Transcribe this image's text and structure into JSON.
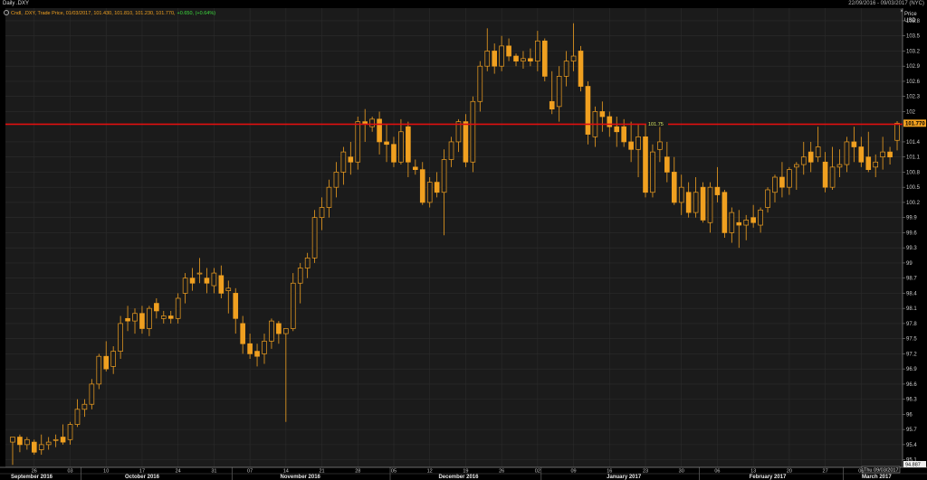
{
  "window": {
    "title": "Daily .DXY",
    "date_range": "22/09/2016 - 09/03/2017 (NYC)"
  },
  "legend": {
    "description": "Cndl, .DXY, Trade Price, 01/03/2017, 101.430, 101.810, 101.230, 101.770,",
    "change": "+0.650, (+0.64%)"
  },
  "colors": {
    "background": "#000000",
    "plot_background": "#1b1b1b",
    "candle": "#f0a020",
    "level_line": "#e01010",
    "last_price_tag": "#f0a020",
    "change_positive": "#3ddc3d"
  },
  "icons": [
    "gear-icon",
    "close-icon"
  ],
  "chart_data": {
    "type": "candlestick",
    "title": "Daily .DXY",
    "ylabel_top": "Price",
    "ylabel_unit": "USD",
    "ylim": [
      94.95,
      104.05
    ],
    "y_ticks": [
      "103.8",
      "103.5",
      "103.2",
      "102.9",
      "102.6",
      "102.3",
      "102",
      "101.4",
      "101.1",
      "100.8",
      "100.5",
      "100.2",
      "99.9",
      "99.6",
      "99.3",
      "99",
      "98.7",
      "98.4",
      "98.1",
      "97.8",
      "97.5",
      "97.2",
      "96.9",
      "96.6",
      "96.3",
      "96",
      "95.7",
      "95.4",
      "95.1"
    ],
    "x_ticks": [
      {
        "label": "26",
        "i": 3
      },
      {
        "label": "03",
        "i": 8
      },
      {
        "label": "10",
        "i": 13
      },
      {
        "label": "17",
        "i": 18
      },
      {
        "label": "24",
        "i": 23
      },
      {
        "label": "31",
        "i": 28
      },
      {
        "label": "07",
        "i": 33
      },
      {
        "label": "14",
        "i": 38
      },
      {
        "label": "21",
        "i": 43
      },
      {
        "label": "28",
        "i": 48
      },
      {
        "label": "05",
        "i": 53
      },
      {
        "label": "12",
        "i": 58
      },
      {
        "label": "19",
        "i": 63
      },
      {
        "label": "26",
        "i": 68
      },
      {
        "label": "02",
        "i": 73
      },
      {
        "label": "09",
        "i": 78
      },
      {
        "label": "16",
        "i": 83
      },
      {
        "label": "23",
        "i": 88
      },
      {
        "label": "30",
        "i": 93
      },
      {
        "label": "06",
        "i": 98
      },
      {
        "label": "13",
        "i": 103
      },
      {
        "label": "20",
        "i": 108
      },
      {
        "label": "27",
        "i": 113
      },
      {
        "label": "06",
        "i": 118
      }
    ],
    "months": [
      {
        "label": "September 2016",
        "i": 3
      },
      {
        "label": "October 2016",
        "i": 18
      },
      {
        "label": "November 2016",
        "i": 40
      },
      {
        "label": "December 2016",
        "i": 62
      },
      {
        "label": "January 2017",
        "i": 85
      },
      {
        "label": "February 2017",
        "i": 105
      },
      {
        "label": "March 2017",
        "i": 118
      }
    ],
    "month_separators": [
      9.5,
      30.5,
      52.5,
      73.5,
      95.5,
      115.5
    ],
    "level_line": {
      "value": 101.75,
      "label": "101.75"
    },
    "last_price": {
      "value": "101.770"
    },
    "bottom_price": {
      "value": "94.887"
    },
    "cursor_date": "Thu 09/03/2017",
    "candles": [
      [
        95.45,
        95.55,
        95.0,
        95.55
      ],
      [
        95.55,
        95.6,
        95.25,
        95.4
      ],
      [
        95.4,
        95.55,
        95.3,
        95.5
      ],
      [
        95.45,
        95.5,
        95.2,
        95.25
      ],
      [
        95.3,
        95.6,
        95.2,
        95.4
      ],
      [
        95.4,
        95.55,
        95.3,
        95.45
      ],
      [
        95.5,
        95.6,
        95.35,
        95.5
      ],
      [
        95.55,
        95.8,
        95.4,
        95.45
      ],
      [
        95.5,
        95.85,
        95.4,
        95.8
      ],
      [
        95.8,
        96.3,
        95.75,
        96.1
      ],
      [
        96.1,
        96.3,
        95.95,
        96.2
      ],
      [
        96.2,
        96.7,
        96.1,
        96.6
      ],
      [
        96.6,
        97.2,
        96.5,
        97.15
      ],
      [
        97.15,
        97.45,
        96.85,
        96.9
      ],
      [
        96.95,
        97.35,
        96.8,
        97.25
      ],
      [
        97.25,
        97.95,
        97.1,
        97.8
      ],
      [
        97.9,
        98.15,
        97.65,
        97.85
      ],
      [
        97.85,
        98.1,
        97.6,
        98.0
      ],
      [
        98.0,
        98.15,
        97.6,
        97.7
      ],
      [
        97.7,
        98.15,
        97.55,
        98.1
      ],
      [
        98.2,
        98.3,
        97.9,
        98.05
      ],
      [
        97.9,
        98.05,
        97.8,
        97.95
      ],
      [
        97.95,
        98.05,
        97.8,
        97.9
      ],
      [
        97.9,
        98.4,
        97.8,
        98.3
      ],
      [
        98.4,
        98.8,
        98.2,
        98.7
      ],
      [
        98.7,
        98.9,
        98.45,
        98.6
      ],
      [
        98.8,
        99.1,
        98.6,
        98.8
      ],
      [
        98.7,
        98.9,
        98.4,
        98.6
      ],
      [
        98.55,
        98.9,
        98.4,
        98.8
      ],
      [
        98.75,
        98.95,
        98.3,
        98.4
      ],
      [
        98.45,
        98.65,
        98.0,
        98.5
      ],
      [
        98.4,
        98.5,
        97.6,
        97.9
      ],
      [
        97.8,
        97.95,
        97.2,
        97.4
      ],
      [
        97.4,
        97.6,
        97.1,
        97.2
      ],
      [
        97.25,
        97.4,
        96.95,
        97.15
      ],
      [
        97.2,
        97.6,
        97.0,
        97.45
      ],
      [
        97.45,
        97.9,
        97.3,
        97.85
      ],
      [
        97.8,
        97.85,
        97.4,
        97.6
      ],
      [
        97.6,
        97.7,
        95.85,
        97.7
      ],
      [
        97.7,
        98.8,
        97.65,
        98.6
      ],
      [
        98.6,
        99.0,
        98.2,
        98.9
      ],
      [
        98.9,
        99.2,
        98.7,
        99.1
      ],
      [
        99.1,
        100.05,
        99.0,
        99.9
      ],
      [
        99.9,
        100.3,
        99.65,
        100.1
      ],
      [
        100.1,
        100.65,
        99.9,
        100.5
      ],
      [
        100.5,
        101.0,
        100.3,
        100.8
      ],
      [
        100.8,
        101.3,
        100.55,
        101.2
      ],
      [
        101.1,
        101.4,
        100.75,
        101.0
      ],
      [
        101.0,
        101.9,
        100.85,
        101.8
      ],
      [
        101.8,
        102.05,
        101.4,
        101.75
      ],
      [
        101.7,
        101.9,
        101.6,
        101.85
      ],
      [
        101.85,
        102.0,
        101.15,
        101.4
      ],
      [
        101.4,
        101.75,
        101.0,
        101.35
      ],
      [
        101.35,
        101.5,
        100.9,
        101.0
      ],
      [
        101.0,
        101.85,
        100.95,
        101.6
      ],
      [
        101.7,
        101.8,
        100.7,
        101.0
      ],
      [
        100.9,
        101.05,
        100.75,
        100.85
      ],
      [
        100.85,
        101.0,
        100.15,
        100.2
      ],
      [
        100.2,
        100.7,
        100.1,
        100.6
      ],
      [
        100.6,
        100.8,
        100.3,
        100.4
      ],
      [
        100.4,
        101.25,
        99.55,
        101.05
      ],
      [
        101.05,
        101.5,
        100.9,
        101.4
      ],
      [
        101.4,
        101.85,
        101.2,
        101.8
      ],
      [
        101.8,
        101.95,
        100.9,
        101.0
      ],
      [
        101.0,
        102.3,
        100.8,
        102.2
      ],
      [
        102.2,
        103.0,
        102.0,
        102.9
      ],
      [
        102.9,
        103.65,
        102.8,
        103.2
      ],
      [
        103.2,
        103.35,
        102.75,
        102.9
      ],
      [
        102.9,
        103.5,
        102.8,
        103.3
      ],
      [
        103.3,
        103.45,
        103.0,
        103.1
      ],
      [
        103.1,
        103.15,
        102.9,
        103.0
      ],
      [
        103.0,
        103.2,
        102.85,
        103.05
      ],
      [
        103.05,
        103.25,
        102.9,
        103.0
      ],
      [
        103.0,
        103.6,
        102.8,
        103.4
      ],
      [
        103.4,
        103.45,
        102.6,
        102.7
      ],
      [
        102.2,
        102.8,
        101.95,
        102.05
      ],
      [
        102.1,
        102.9,
        101.8,
        102.7
      ],
      [
        102.7,
        103.2,
        102.5,
        103.0
      ],
      [
        103.0,
        103.75,
        102.8,
        103.1
      ],
      [
        103.2,
        103.3,
        102.4,
        102.5
      ],
      [
        102.5,
        102.6,
        101.35,
        101.55
      ],
      [
        101.5,
        102.1,
        101.3,
        102.0
      ],
      [
        102.0,
        102.2,
        101.6,
        101.9
      ],
      [
        101.9,
        102.0,
        101.5,
        101.7
      ],
      [
        101.7,
        101.9,
        101.3,
        101.6
      ],
      [
        101.7,
        101.85,
        101.3,
        101.4
      ],
      [
        101.4,
        101.8,
        101.0,
        101.25
      ],
      [
        101.25,
        101.75,
        100.7,
        101.5
      ],
      [
        101.5,
        101.75,
        100.3,
        100.4
      ],
      [
        100.4,
        101.35,
        100.3,
        101.2
      ],
      [
        101.25,
        101.75,
        101.0,
        101.4
      ],
      [
        101.1,
        101.4,
        100.6,
        100.8
      ],
      [
        100.8,
        101.1,
        100.15,
        100.2
      ],
      [
        100.2,
        100.75,
        99.95,
        100.5
      ],
      [
        100.4,
        100.6,
        99.9,
        100.0
      ],
      [
        100.0,
        100.7,
        99.9,
        100.4
      ],
      [
        100.5,
        100.6,
        99.8,
        99.85
      ],
      [
        99.8,
        100.6,
        99.6,
        100.5
      ],
      [
        100.5,
        100.9,
        100.2,
        100.35
      ],
      [
        100.4,
        100.45,
        99.5,
        99.6
      ],
      [
        99.6,
        100.1,
        99.4,
        100.0
      ],
      [
        99.8,
        100.05,
        99.3,
        99.75
      ],
      [
        99.75,
        99.95,
        99.45,
        99.85
      ],
      [
        99.9,
        100.15,
        99.7,
        99.8
      ],
      [
        99.75,
        100.1,
        99.6,
        100.05
      ],
      [
        100.1,
        100.5,
        100.0,
        100.45
      ],
      [
        100.4,
        100.75,
        100.2,
        100.7
      ],
      [
        100.7,
        101.0,
        100.3,
        100.5
      ],
      [
        100.5,
        100.9,
        100.35,
        100.85
      ],
      [
        100.9,
        101.0,
        100.45,
        100.95
      ],
      [
        100.95,
        101.4,
        100.75,
        101.1
      ],
      [
        101.2,
        101.4,
        100.8,
        101.0
      ],
      [
        101.1,
        101.7,
        101.0,
        101.3
      ],
      [
        101.0,
        101.2,
        100.4,
        100.5
      ],
      [
        100.5,
        101.3,
        100.45,
        100.9
      ],
      [
        100.9,
        101.25,
        100.7,
        100.95
      ],
      [
        100.95,
        101.5,
        100.8,
        101.4
      ],
      [
        101.4,
        101.7,
        101.0,
        101.3
      ],
      [
        101.3,
        101.5,
        100.9,
        101.0
      ],
      [
        101.1,
        101.6,
        100.8,
        100.85
      ],
      [
        100.9,
        101.15,
        100.7,
        101.0
      ],
      [
        101.1,
        101.5,
        100.85,
        101.2
      ],
      [
        101.2,
        101.3,
        100.95,
        101.1
      ],
      [
        101.43,
        101.81,
        101.23,
        101.77
      ]
    ]
  }
}
